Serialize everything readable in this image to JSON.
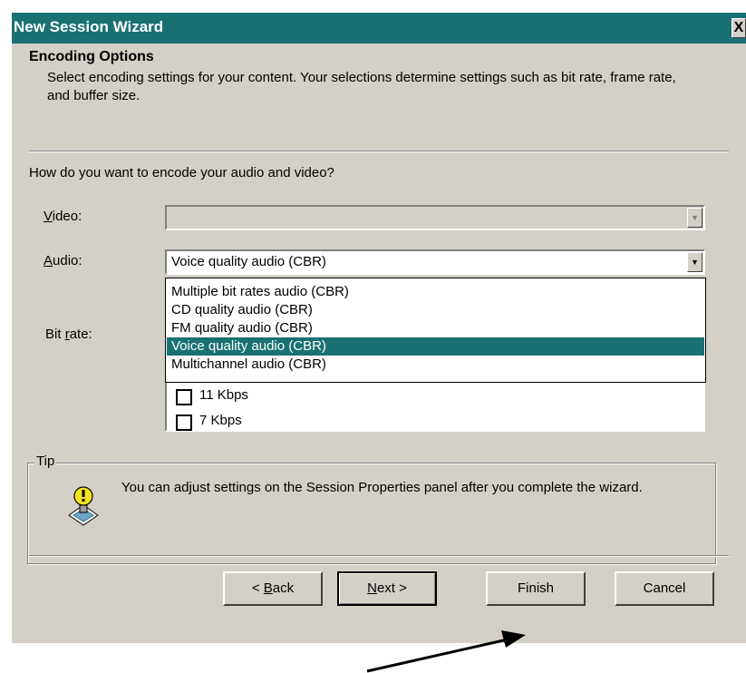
{
  "window": {
    "title": "New Session Wizard",
    "close_glyph": "X",
    "title_color": "#197173"
  },
  "header": {
    "title": "Encoding Options",
    "description": "Select encoding settings for your content. Your selections determine settings such as bit rate, frame rate, and buffer size."
  },
  "main": {
    "question": "How do you want to encode your audio and video?",
    "video": {
      "label_mnemonic": "V",
      "label_rest": "ideo:",
      "value": ""
    },
    "audio": {
      "label_mnemonic": "A",
      "label_rest": "udio:",
      "value": "Voice quality audio (CBR)"
    },
    "bitrate": {
      "label_pre": "Bit ",
      "label_mnemonic": "r",
      "label_rest": "ate:"
    },
    "audio_options": [
      {
        "label": "Multiple bit rates audio (CBR)",
        "selected": false
      },
      {
        "label": "CD quality audio (CBR)",
        "selected": false
      },
      {
        "label": "FM quality audio (CBR)",
        "selected": false
      },
      {
        "label": "Voice quality audio (CBR)",
        "selected": true
      },
      {
        "label": "Multichannel audio (CBR)",
        "selected": false
      }
    ],
    "bitrate_options": [
      {
        "label": "11 Kbps",
        "checked": false
      },
      {
        "label": "7 Kbps",
        "checked": false
      }
    ]
  },
  "tip": {
    "legend": "Tip",
    "text": "You can adjust settings on the Session Properties panel after you complete the wizard.",
    "icon": "lightbulb-icon"
  },
  "buttons": {
    "back_pre": "< ",
    "back_mnemonic": "B",
    "back_rest": "ack",
    "next_mnemonic": "N",
    "next_rest": "ext >",
    "finish": "Finish",
    "cancel": "Cancel"
  }
}
